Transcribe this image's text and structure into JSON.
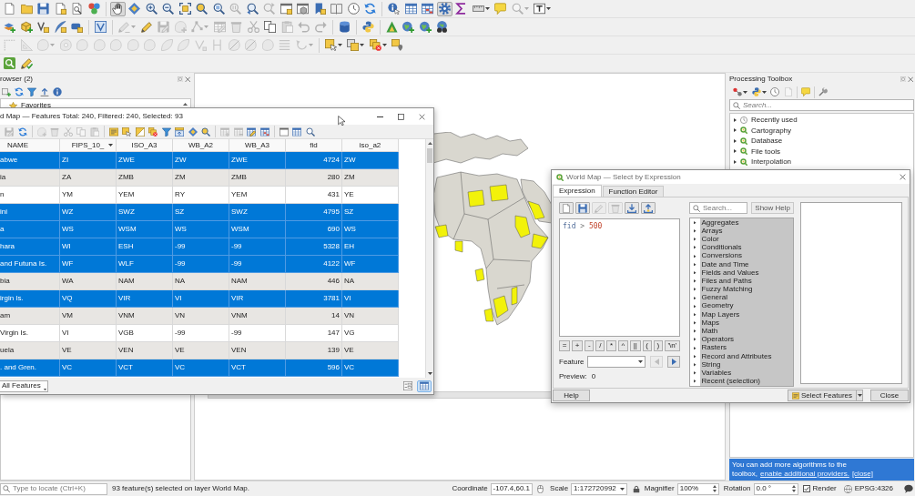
{
  "toolbars": [
    {
      "groups": [
        [
          {
            "kind": "blank-page",
            "disabled": false,
            "selected": false,
            "dropdown": false
          },
          {
            "kind": "folder",
            "disabled": false,
            "selected": false,
            "dropdown": false
          },
          {
            "kind": "floppy-disk",
            "disabled": false,
            "selected": false,
            "dropdown": false
          },
          {
            "kind": "page-square",
            "disabled": false,
            "selected": false,
            "dropdown": false
          },
          {
            "kind": "page-magnifier",
            "disabled": false,
            "selected": false,
            "dropdown": false
          },
          {
            "kind": "style-dots",
            "disabled": false,
            "selected": false,
            "dropdown": false
          }
        ],
        [
          {
            "kind": "hand",
            "disabled": false,
            "selected": true,
            "dropdown": false
          },
          {
            "kind": "pan-diamond",
            "disabled": false,
            "selected": false,
            "dropdown": false
          },
          {
            "kind": "zoom-in",
            "disabled": false,
            "selected": false,
            "dropdown": false
          },
          {
            "kind": "zoom-out",
            "disabled": false,
            "selected": false,
            "dropdown": false
          },
          {
            "kind": "corner-brackets",
            "disabled": false,
            "selected": false,
            "dropdown": false
          },
          {
            "kind": "solid-magnifier",
            "disabled": false,
            "selected": false,
            "dropdown": false
          },
          {
            "kind": "magnifier-square",
            "disabled": false,
            "selected": false,
            "dropdown": false
          },
          {
            "kind": "magnifier-lines",
            "disabled": true,
            "selected": false,
            "dropdown": false
          },
          {
            "kind": "magnifier-back",
            "disabled": false,
            "selected": false,
            "dropdown": false
          },
          {
            "kind": "magnifier-forward",
            "disabled": true,
            "selected": false,
            "dropdown": false
          },
          {
            "kind": "map-window",
            "disabled": false,
            "selected": false,
            "dropdown": false
          },
          {
            "kind": "cube-window",
            "disabled": false,
            "selected": false,
            "dropdown": false
          },
          {
            "kind": "bookmark-plus",
            "disabled": false,
            "selected": false,
            "dropdown": false
          },
          {
            "kind": "book",
            "disabled": false,
            "selected": false,
            "dropdown": false
          },
          {
            "kind": "clock",
            "disabled": false,
            "selected": false,
            "dropdown": false
          },
          {
            "kind": "refresh",
            "disabled": false,
            "selected": false,
            "dropdown": false
          }
        ],
        [
          {
            "kind": "info-cursor",
            "disabled": false,
            "selected": false,
            "dropdown": false
          },
          {
            "kind": "table",
            "disabled": false,
            "selected": false,
            "dropdown": false
          },
          {
            "kind": "table-marked",
            "disabled": false,
            "selected": false,
            "dropdown": false
          },
          {
            "kind": "gear",
            "disabled": false,
            "selected": true,
            "dropdown": false
          },
          {
            "kind": "sigma",
            "disabled": false,
            "selected": false,
            "dropdown": false
          },
          {
            "kind": "ruler",
            "disabled": false,
            "selected": false,
            "dropdown": true
          },
          {
            "kind": "speech-bubble",
            "disabled": false,
            "selected": false,
            "dropdown": false
          },
          {
            "kind": "magnifier",
            "disabled": true,
            "selected": false,
            "dropdown": true
          },
          {
            "kind": "text-box",
            "disabled": false,
            "selected": false,
            "dropdown": true
          }
        ]
      ]
    },
    {
      "groups": [
        [
          {
            "kind": "layers-plus",
            "disabled": false,
            "dropdown": false
          },
          {
            "kind": "box-plus",
            "disabled": false,
            "dropdown": false
          },
          {
            "kind": "chevron-square",
            "disabled": false,
            "dropdown": false
          },
          {
            "kind": "feather-plus",
            "disabled": false,
            "dropdown": false
          },
          {
            "kind": "tile-plus",
            "disabled": false,
            "dropdown": false
          }
        ],
        [
          {
            "kind": "chevron-frame",
            "disabled": false,
            "dropdown": false
          }
        ],
        [
          {
            "kind": "pencil-line",
            "disabled": true,
            "dropdown": true
          },
          {
            "kind": "pencil",
            "disabled": false,
            "dropdown": false
          },
          {
            "kind": "floppy-pencil",
            "disabled": true,
            "dropdown": false
          },
          {
            "kind": "blob-plus",
            "disabled": true,
            "dropdown": false
          },
          {
            "kind": "nodes-line",
            "disabled": true,
            "dropdown": true
          },
          {
            "kind": "table-pencil",
            "disabled": true,
            "dropdown": false
          },
          {
            "kind": "trash",
            "disabled": true,
            "dropdown": false
          },
          {
            "kind": "scissors",
            "disabled": true,
            "dropdown": false
          },
          {
            "kind": "two-pages",
            "disabled": false,
            "dropdown": false
          },
          {
            "kind": "clipboard",
            "disabled": true,
            "dropdown": false
          },
          {
            "kind": "undo",
            "disabled": true,
            "dropdown": false
          },
          {
            "kind": "redo",
            "disabled": true,
            "dropdown": false
          }
        ],
        [
          {
            "kind": "database",
            "disabled": false,
            "dropdown": false
          }
        ],
        [
          {
            "kind": "twin-shapes",
            "disabled": false,
            "dropdown": false
          }
        ],
        [
          {
            "kind": "triangle",
            "disabled": false,
            "dropdown": false
          },
          {
            "kind": "globe-plus",
            "disabled": false,
            "dropdown": false
          },
          {
            "kind": "globe-plus",
            "disabled": false,
            "dropdown": false
          },
          {
            "kind": "globe-binoculars",
            "disabled": false,
            "dropdown": false
          }
        ]
      ]
    },
    {
      "groups": [
        [
          {
            "kind": "angle",
            "disabled": true,
            "dropdown": false
          },
          {
            "kind": "set-square",
            "disabled": true,
            "dropdown": false
          },
          {
            "kind": "blob",
            "disabled": true,
            "dropdown": true
          },
          {
            "kind": "blob-ring",
            "disabled": true,
            "dropdown": false
          },
          {
            "kind": "blob",
            "disabled": true,
            "dropdown": false
          },
          {
            "kind": "blob",
            "disabled": true,
            "dropdown": false
          },
          {
            "kind": "blob",
            "disabled": true,
            "dropdown": false
          },
          {
            "kind": "blob",
            "disabled": true,
            "dropdown": false
          },
          {
            "kind": "blob",
            "disabled": true,
            "dropdown": false
          },
          {
            "kind": "leaf",
            "disabled": true,
            "dropdown": false
          },
          {
            "kind": "leaf",
            "disabled": true,
            "dropdown": false
          },
          {
            "kind": "chevron-node",
            "disabled": true,
            "dropdown": false
          },
          {
            "kind": "split-lines",
            "disabled": true,
            "dropdown": false
          },
          {
            "kind": "blob-cut",
            "disabled": true,
            "dropdown": false
          },
          {
            "kind": "blob-cut",
            "disabled": true,
            "dropdown": false
          },
          {
            "kind": "blob",
            "disabled": true,
            "dropdown": false
          },
          {
            "kind": "lines-stack",
            "disabled": true,
            "dropdown": false
          },
          {
            "kind": "rotate-arrow",
            "disabled": true,
            "dropdown": true
          }
        ],
        [
          {
            "kind": "square-cursor",
            "disabled": false,
            "dropdown": true
          },
          {
            "kind": "stacked-squares",
            "disabled": false,
            "dropdown": true
          },
          {
            "kind": "squares-cross",
            "disabled": false,
            "dropdown": true
          },
          {
            "kind": "square-pin",
            "disabled": false,
            "dropdown": false
          }
        ]
      ]
    },
    {
      "groups": [
        [
          {
            "kind": "magnifier-tile"
          },
          {
            "kind": "pencil-check"
          }
        ]
      ]
    }
  ],
  "browser_panel": {
    "title": "rowser (2)",
    "toolbar": [
      {
        "kind": "square-plus"
      },
      {
        "kind": "refresh"
      },
      {
        "kind": "filter"
      },
      {
        "kind": "arrow-bar"
      },
      {
        "kind": "info"
      }
    ],
    "items": [
      {
        "label": "Favorites"
      }
    ]
  },
  "processing_toolbox": {
    "title": "Processing Toolbox",
    "toolbar": [
      [
        {
          "kind": "linked-dots",
          "disabled": false,
          "dropdown": true
        },
        {
          "kind": "twin-shapes",
          "disabled": false,
          "dropdown": true
        },
        {
          "kind": "clock",
          "disabled": false,
          "dropdown": false
        },
        {
          "kind": "blank-page",
          "disabled": true,
          "dropdown": false
        }
      ],
      [
        {
          "kind": "speech-bubble",
          "disabled": false,
          "dropdown": false
        }
      ],
      [
        {
          "kind": "wrench",
          "disabled": false,
          "dropdown": false
        }
      ]
    ],
    "search": {
      "placeholder": "Search..."
    },
    "items": [
      {
        "label": "Recently used",
        "kind": "clock",
        "expanded": false
      },
      {
        "label": "Cartography",
        "kind": "ring-tail",
        "expanded": false
      },
      {
        "label": "Database",
        "kind": "ring-tail",
        "expanded": false
      },
      {
        "label": "File tools",
        "kind": "ring-tail",
        "expanded": false
      },
      {
        "label": "Interpolation",
        "kind": "ring-tail",
        "expanded": false
      }
    ],
    "message": {
      "text": "You can add more algorithms to the toolbox,",
      "link": "enable additional providers.",
      "close": "[close]"
    }
  },
  "attribute_table": {
    "title": "d Map — Features Total: 240, Filtered: 240, Selected: 93",
    "toolbar": [
      [
        {
          "kind": "floppy-pencil",
          "disabled": true
        },
        {
          "kind": "refresh",
          "disabled": false
        }
      ],
      [
        {
          "kind": "blob-plus",
          "disabled": true
        },
        {
          "kind": "trash",
          "disabled": true
        },
        {
          "kind": "scissors",
          "disabled": true
        },
        {
          "kind": "two-pages",
          "disabled": true
        },
        {
          "kind": "clipboard",
          "disabled": true
        }
      ],
      [
        {
          "kind": "square-lines",
          "disabled": false
        },
        {
          "kind": "square-cursor",
          "disabled": false
        },
        {
          "kind": "half-square",
          "disabled": false
        },
        {
          "kind": "squares-cross",
          "disabled": false
        },
        {
          "kind": "filter",
          "disabled": false
        },
        {
          "kind": "list-arrow",
          "disabled": false
        },
        {
          "kind": "pan-diamond",
          "disabled": false
        },
        {
          "kind": "solid-magnifier",
          "disabled": false
        }
      ],
      [
        {
          "kind": "table-plus",
          "disabled": true
        },
        {
          "kind": "table-minus",
          "disabled": true
        },
        {
          "kind": "table-pencil",
          "disabled": false
        },
        {
          "kind": "table-marked",
          "disabled": false
        }
      ],
      [
        {
          "kind": "window",
          "disabled": false
        },
        {
          "kind": "table",
          "disabled": false
        },
        {
          "kind": "magnifier",
          "disabled": false
        }
      ]
    ],
    "columns": [
      {
        "label": "NAME",
        "kind": "text",
        "sorted": false
      },
      {
        "label": "FIPS_10_",
        "kind": "text",
        "sorted": true
      },
      {
        "label": "ISO_A3",
        "kind": "text",
        "sorted": false
      },
      {
        "label": "WB_A2",
        "kind": "text",
        "sorted": false
      },
      {
        "label": "WB_A3",
        "kind": "text",
        "sorted": false
      },
      {
        "label": "fid",
        "kind": "number",
        "sorted": false
      },
      {
        "label": "iso_a2",
        "kind": "text",
        "sorted": false
      }
    ],
    "rows": [
      {
        "cells": [
          "abwe",
          "ZI",
          "ZWE",
          "ZW",
          "ZWE",
          "4724",
          "ZW"
        ],
        "selected": true
      },
      {
        "cells": [
          "ia",
          "ZA",
          "ZMB",
          "ZM",
          "ZMB",
          "280",
          "ZM"
        ],
        "selected": false
      },
      {
        "cells": [
          "n",
          "YM",
          "YEM",
          "RY",
          "YEM",
          "431",
          "YE"
        ],
        "selected": false
      },
      {
        "cells": [
          "ini",
          "WZ",
          "SWZ",
          "SZ",
          "SWZ",
          "4795",
          "SZ"
        ],
        "selected": true
      },
      {
        "cells": [
          "a",
          "WS",
          "WSM",
          "WS",
          "WSM",
          "690",
          "WS"
        ],
        "selected": true
      },
      {
        "cells": [
          "hara",
          "WI",
          "ESH",
          "-99",
          "-99",
          "5328",
          "EH"
        ],
        "selected": true
      },
      {
        "cells": [
          "and Futuna Is.",
          "WF",
          "WLF",
          "-99",
          "-99",
          "4122",
          "WF"
        ],
        "selected": true
      },
      {
        "cells": [
          "bia",
          "WA",
          "NAM",
          "NA",
          "NAM",
          "446",
          "NA"
        ],
        "selected": false
      },
      {
        "cells": [
          "irgin Is.",
          "VQ",
          "VIR",
          "VI",
          "VIR",
          "3781",
          "VI"
        ],
        "selected": true
      },
      {
        "cells": [
          "am",
          "VM",
          "VNM",
          "VN",
          "VNM",
          "14",
          "VN"
        ],
        "selected": false
      },
      {
        "cells": [
          "Virgin Is.",
          "VI",
          "VGB",
          "-99",
          "-99",
          "147",
          "VG"
        ],
        "selected": false
      },
      {
        "cells": [
          "uela",
          "VE",
          "VEN",
          "VE",
          "VEN",
          "139",
          "VE"
        ],
        "selected": false
      },
      {
        "cells": [
          ". and Gren.",
          "VC",
          "VCT",
          "VC",
          "VCT",
          "596",
          "VC"
        ],
        "selected": true
      }
    ],
    "filter_button": "All Features",
    "view_modes": [
      {
        "kind": "form",
        "selected": false
      },
      {
        "kind": "table",
        "selected": true
      }
    ]
  },
  "expression_dialog": {
    "title": "World Map — Select by Expression",
    "tabs": [
      {
        "label": "Expression",
        "selected": true
      },
      {
        "label": "Function Editor",
        "selected": false
      }
    ],
    "toolbar": [
      {
        "kind": "blank-page",
        "disabled": false
      },
      {
        "kind": "floppy-disk",
        "disabled": false
      },
      {
        "kind": "pencil",
        "disabled": true
      },
      {
        "kind": "trash",
        "disabled": true
      },
      {
        "kind": "download",
        "disabled": false
      },
      {
        "kind": "upload",
        "disabled": false
      }
    ],
    "expression": [
      {
        "text": "fid",
        "kind": "field"
      },
      {
        "text": ">",
        "kind": "operator"
      },
      {
        "text": "500",
        "kind": "number"
      }
    ],
    "operators": [
      "=",
      "+",
      "-",
      "/",
      "*",
      "^",
      "||",
      "(",
      ")",
      "'\\n'"
    ],
    "feature_label": "Feature",
    "nav": [
      {
        "kind": "previous",
        "disabled": true
      },
      {
        "kind": "next",
        "disabled": false
      }
    ],
    "preview_label": "Preview:",
    "preview_value": "0",
    "search": {
      "placeholder": "Search..."
    },
    "show_help": "Show Help",
    "functions": [
      {
        "label": "Aggregates",
        "expanded": false
      },
      {
        "label": "Arrays",
        "expanded": false
      },
      {
        "label": "Color",
        "expanded": false
      },
      {
        "label": "Conditionals",
        "expanded": false
      },
      {
        "label": "Conversions",
        "expanded": false
      },
      {
        "label": "Date and Time",
        "expanded": false
      },
      {
        "label": "Fields and Values",
        "expanded": false
      },
      {
        "label": "Files and Paths",
        "expanded": false
      },
      {
        "label": "Fuzzy Matching",
        "expanded": false
      },
      {
        "label": "General",
        "expanded": false
      },
      {
        "label": "Geometry",
        "expanded": false
      },
      {
        "label": "Map Layers",
        "expanded": false
      },
      {
        "label": "Maps",
        "expanded": false
      },
      {
        "label": "Math",
        "expanded": false
      },
      {
        "label": "Operators",
        "expanded": false
      },
      {
        "label": "Rasters",
        "expanded": false
      },
      {
        "label": "Record and Attributes",
        "expanded": false
      },
      {
        "label": "String",
        "expanded": false
      },
      {
        "label": "Variables",
        "expanded": false
      },
      {
        "label": "Recent (selection)",
        "expanded": false
      }
    ],
    "buttons": [
      {
        "label": "Help",
        "kind": "plain"
      },
      {
        "label": "Select Features",
        "kind": "split"
      },
      {
        "label": "Close",
        "kind": "plain"
      }
    ]
  },
  "status_bar": {
    "locator": {
      "placeholder": "Type to locate (Ctrl+K)"
    },
    "message": "93 feature(s) selected on layer World Map.",
    "coordinate_label": "Coordinate",
    "coordinate": "-107.4,60.1",
    "scale_label": "Scale",
    "scale": "1:172720992",
    "magnifier_label": "Magnifier",
    "magnifier": "100%",
    "rotation_label": "Rotation",
    "rotation": "0.0 °",
    "render": {
      "label": "Render",
      "checked": true
    },
    "crs": "EPSG:4326"
  }
}
